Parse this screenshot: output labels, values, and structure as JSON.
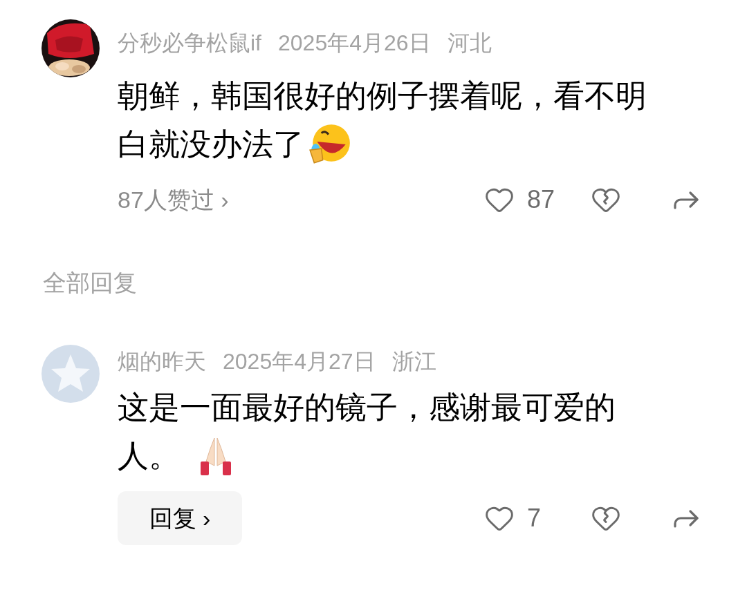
{
  "comments": [
    {
      "author": "分秒必争松鼠if",
      "date": "2025年4月26日",
      "region": "河北",
      "text_lines": [
        "朝鲜，韩国很好的例子摆着呢，看不明",
        "白就没办法了"
      ],
      "likes_summary": "87人赞过 ›",
      "like_count": "87"
    }
  ],
  "section_title": "全部回复",
  "replies": [
    {
      "author": "烟的昨天",
      "date": "2025年4月27日",
      "region": "浙江",
      "text_lines": [
        "这是一面最好的镜子，感谢最可爱的",
        "人。"
      ],
      "reply_button": "回复 ›",
      "like_count": "7"
    }
  ]
}
